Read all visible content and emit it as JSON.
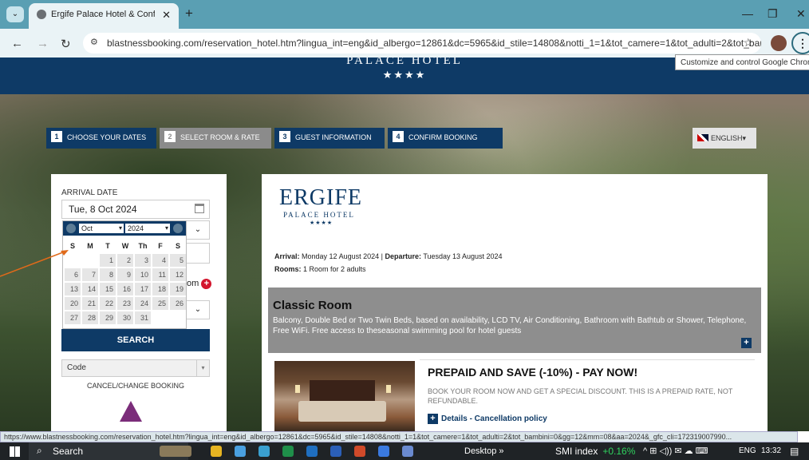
{
  "browser": {
    "tab_title": "Ergife Palace Hotel & Conferen",
    "tab_close": "✕",
    "new_tab": "+",
    "menu_glyph": "⌄",
    "min_glyph": "—",
    "max_glyph": "❐",
    "close_glyph": "✕",
    "back": "←",
    "forward": "→",
    "reload": "↻",
    "url": "blastnessbooking.com/reservation_hotel.htm?lingua_int=eng&id_albergo=12861&dc=5965&id_stile=14808&notti_1=1&tot_camere=1&tot_adulti=2&tot_bam...",
    "tune_glyph": "⚙",
    "star_glyph": "☆",
    "kebab_glyph": "⋮",
    "tooltip": "Customize and control Google Chrome"
  },
  "header": {
    "brand": "PALACE HOTEL",
    "stars": "★★★★"
  },
  "steps": [
    {
      "num": "1",
      "label": "CHOOSE YOUR DATES"
    },
    {
      "num": "2",
      "label": "SELECT ROOM & RATE"
    },
    {
      "num": "3",
      "label": "GUEST INFORMATION"
    },
    {
      "num": "4",
      "label": "CONFIRM BOOKING"
    }
  ],
  "language": {
    "label": "ENGLISH",
    "caret": "▾"
  },
  "booking": {
    "arrival_label": "ARRIVAL DATE",
    "arrival_value": "Tue, 8 Oct 2024",
    "rooms_extra": "om",
    "plus": "+",
    "search_label": "SEARCH",
    "code_placeholder": "Code",
    "code_caret": "▾",
    "cancel_label": "CANCEL/CHANGE BOOKING",
    "select_caret": "⌄"
  },
  "datepicker": {
    "month": "Oct",
    "year": "2024",
    "dow": [
      "S",
      "M",
      "T",
      "W",
      "Th",
      "F",
      "S"
    ],
    "days": [
      "",
      "",
      "1",
      "2",
      "3",
      "4",
      "5",
      "6",
      "7",
      "8",
      "9",
      "10",
      "11",
      "12",
      "13",
      "14",
      "15",
      "16",
      "17",
      "18",
      "19",
      "20",
      "21",
      "22",
      "23",
      "24",
      "25",
      "26",
      "27",
      "28",
      "29",
      "30",
      "31",
      "",
      ""
    ]
  },
  "card": {
    "logo_main": "ERGIFE",
    "logo_sub": "PALACE HOTEL",
    "logo_stars": "★★★★",
    "arrival_key": "Arrival:",
    "arrival_val": "Monday 12 August 2024",
    "departure_key": "Departure:",
    "departure_val": "Tuesday 13 August 2024",
    "rooms_key": "Rooms:",
    "rooms_val": "1 Room for 2 adults",
    "room_name": "Classic Room",
    "room_desc": "Balcony, Double Bed or Two Twin Beds, based on availability, LCD TV, Air Conditioning, Bathroom with Bathtub or Shower, Telephone, Free WiFi. Free access to theseasonal swimming pool for hotel guests",
    "plus": "+",
    "offer_title": "PREPAID AND SAVE (-10%) - PAY NOW!",
    "offer_desc": "BOOK YOUR ROOM NOW AND GET A SPECIAL DISCOUNT. THIS IS A PREPAID RATE, NOT REFUNDABLE.",
    "offer_link": "Details - Cancellation policy"
  },
  "status_url": "https://www.blastnessbooking.com/reservation_hotel.htm?lingua_int=eng&id_albergo=12861&dc=5965&id_stile=14808&notti_1=1&tot_camere=1&tot_adulti=2&tot_bambini=0&gg=12&mm=08&aa=2024&_gfc_cli=172319007990...",
  "taskbar": {
    "search": "Search",
    "search_glyph": "⌕",
    "desktop": "Desktop",
    "desktop_chevron": "»",
    "smi": "SMI index",
    "smi_change": "+0.16%",
    "tray": "^  ⊞  ◁))  ✉  ☁  ⌨",
    "lang": "ENG",
    "time": "13:32",
    "notif": "▤"
  },
  "colors": {
    "brand": "#0e3a66",
    "accent_red": "#d3162e",
    "step_active": "#8b8b8b"
  }
}
